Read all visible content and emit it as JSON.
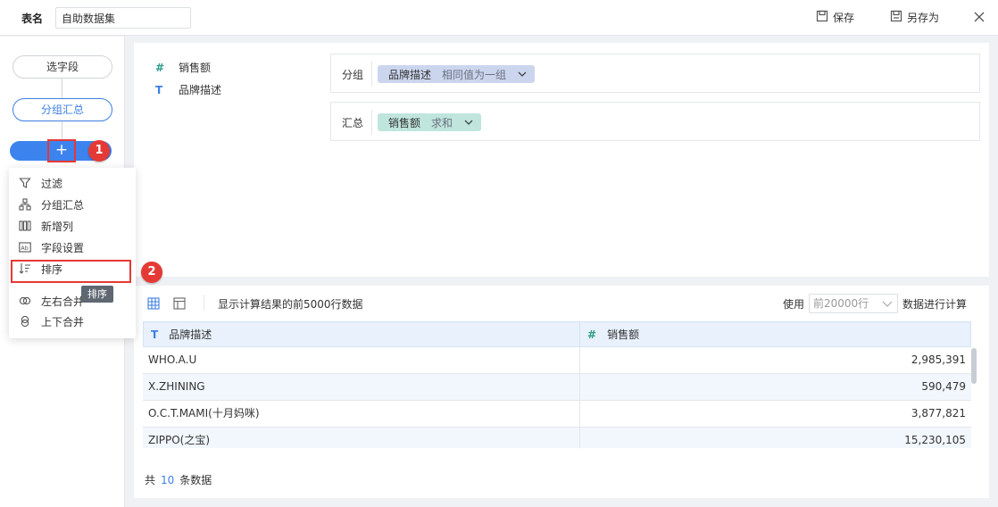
{
  "header": {
    "table_name_label": "表名",
    "table_name_value": "自助数据集",
    "save_label": "保存",
    "save_as_label": "另存为"
  },
  "sidebar": {
    "select_fields_label": "选字段",
    "group_summary_label": "分组汇总",
    "add_symbol": "+"
  },
  "callouts": {
    "badge1": "1",
    "badge2": "2"
  },
  "add_menu": {
    "items": [
      {
        "label": "过滤",
        "icon": "filter-icon"
      },
      {
        "label": "分组汇总",
        "icon": "group-icon"
      },
      {
        "label": "新增列",
        "icon": "add-column-icon"
      },
      {
        "label": "字段设置",
        "icon": "field-settings-icon"
      },
      {
        "label": "排序",
        "icon": "sort-icon"
      },
      {
        "label": "左右合并",
        "icon": "merge-horizontal-icon"
      },
      {
        "label": "上下合并",
        "icon": "merge-vertical-icon"
      }
    ],
    "tooltip": "排序"
  },
  "fields": [
    {
      "type_symbol": "#",
      "label": "销售额"
    },
    {
      "type_symbol": "T",
      "label": "品牌描述"
    }
  ],
  "group_zone": {
    "label": "分组",
    "chip_field": "品牌描述",
    "chip_mode": "相同值为一组"
  },
  "summary_zone": {
    "label": "汇总",
    "chip_field": "销售额",
    "chip_mode": "求和"
  },
  "preview": {
    "info_text": "显示计算结果的前5000行数据",
    "use_label": "使用",
    "row_select_value": "前20000行",
    "after_label": "数据进行计算",
    "columns": [
      {
        "type_symbol": "T",
        "label": "品牌描述"
      },
      {
        "type_symbol": "#",
        "label": "销售额"
      }
    ],
    "rows": [
      {
        "brand": "WHO.A.U",
        "sales": "2,985,391"
      },
      {
        "brand": "X.ZHINING",
        "sales": "590,479"
      },
      {
        "brand": "O.C.T.MAMI(十月妈咪)",
        "sales": "3,877,821"
      },
      {
        "brand": "ZIPPO(之宝)",
        "sales": "15,230,105"
      }
    ],
    "total_prefix": "共",
    "total_count": "10",
    "total_suffix": "条数据"
  },
  "colors": {
    "accent": "#3d83ee",
    "callout_red": "#e53935",
    "group_chip": "#cbd6ee",
    "summary_chip": "#bfe5dc"
  }
}
